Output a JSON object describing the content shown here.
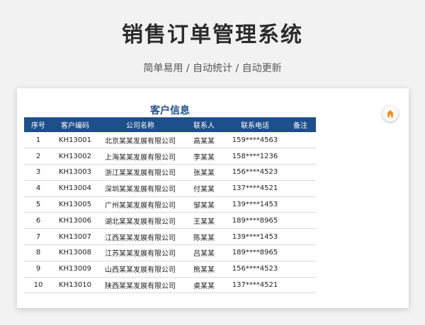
{
  "header": {
    "title": "销售订单管理系统",
    "subtitle": "简单易用 / 自动统计 / 自动更新"
  },
  "table": {
    "title": "客户信息",
    "columns": [
      "序号",
      "客户编码",
      "公司名称",
      "联系人",
      "联系电话",
      "备注"
    ],
    "rows": [
      [
        "1",
        "KH13001",
        "北京某某发展有限公司",
        "高某某",
        "159****4563",
        ""
      ],
      [
        "2",
        "KH13002",
        "上海某某发展有限公司",
        "李某某",
        "158****1236",
        ""
      ],
      [
        "3",
        "KH13003",
        "浙江某某发展有限公司",
        "张某某",
        "156****4523",
        ""
      ],
      [
        "4",
        "KH13004",
        "深圳某某发展有限公司",
        "付某某",
        "137****4521",
        ""
      ],
      [
        "5",
        "KH13005",
        "广州某某发展有限公司",
        "邹某某",
        "139****1453",
        ""
      ],
      [
        "6",
        "KH13006",
        "湖北某某发展有限公司",
        "王某某",
        "189****8965",
        ""
      ],
      [
        "7",
        "KH13007",
        "江西某某发展有限公司",
        "陈某某",
        "139****1453",
        ""
      ],
      [
        "8",
        "KH13008",
        "江苏某某发展有限公司",
        "吕某某",
        "189****8965",
        ""
      ],
      [
        "9",
        "KH13009",
        "山西某某发展有限公司",
        "熊某某",
        "156****4523",
        ""
      ],
      [
        "10",
        "KH13010",
        "陕西某某发展有限公司",
        "桌某某",
        "137****4521",
        ""
      ]
    ]
  },
  "colors": {
    "header_bg": "#1d4f8a",
    "title_blue": "#1f4e8c",
    "home_icon": "#f08c1e"
  },
  "icons": {
    "home": "home-icon"
  }
}
